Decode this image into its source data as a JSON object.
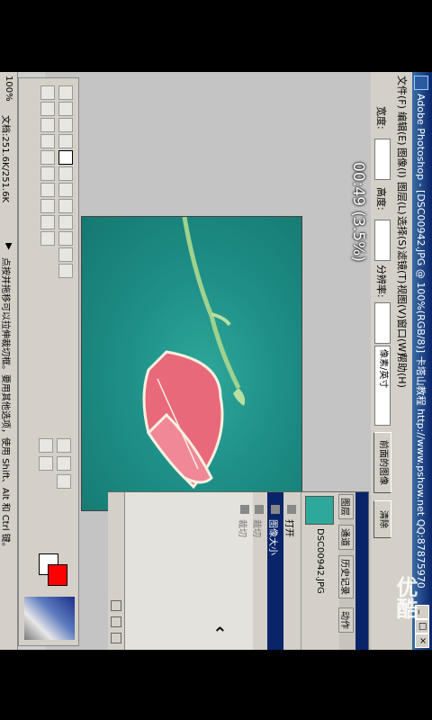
{
  "window": {
    "title": "Adobe Photoshop - [DSC00942.JPG @ 100%(RGB/8)] 卡塔山教程 http://www.pshow.net QQ:87875970",
    "buttons": [
      "_",
      "□",
      "×"
    ]
  },
  "menu": [
    "文件(F)",
    "编辑(E)",
    "图像(I)",
    "图层(L)",
    "选择(S)",
    "滤镜(T)",
    "视图(V)",
    "窗口(W)",
    "帮助(H)"
  ],
  "options": {
    "width_label": "宽度:",
    "height_label": "高度:",
    "resolution_label": "分辨率:",
    "unit_select": "像素/英寸",
    "front_image_button": "前面的图像",
    "clear_button": "清除"
  },
  "overlay": {
    "timecode": "00:49 (3.5%)",
    "chevron": "⌃",
    "watermark": "优酷"
  },
  "history_panel": {
    "tabs": [
      "图层",
      "通道",
      "历史记录",
      "动作"
    ],
    "document": "DSC00942.JPG",
    "items": [
      {
        "label": "打开",
        "selected": false
      },
      {
        "label": "图像大小",
        "selected": true
      },
      {
        "label": "裁切",
        "selected": false
      },
      {
        "label": "裁切",
        "selected": false
      }
    ]
  },
  "status": {
    "zoom": "100%",
    "doc_size": "文档:251.6K/251.6K",
    "hint": "点按并拖移可以拉伸裁切框。要用其他选项，使用 Shift、Alt 和 Ctrl 键。"
  },
  "colors": {
    "foreground": "#ff0000",
    "background": "#ffffff",
    "image_teal": "#1e8f87",
    "leaf_pink": "#e86a7a"
  }
}
